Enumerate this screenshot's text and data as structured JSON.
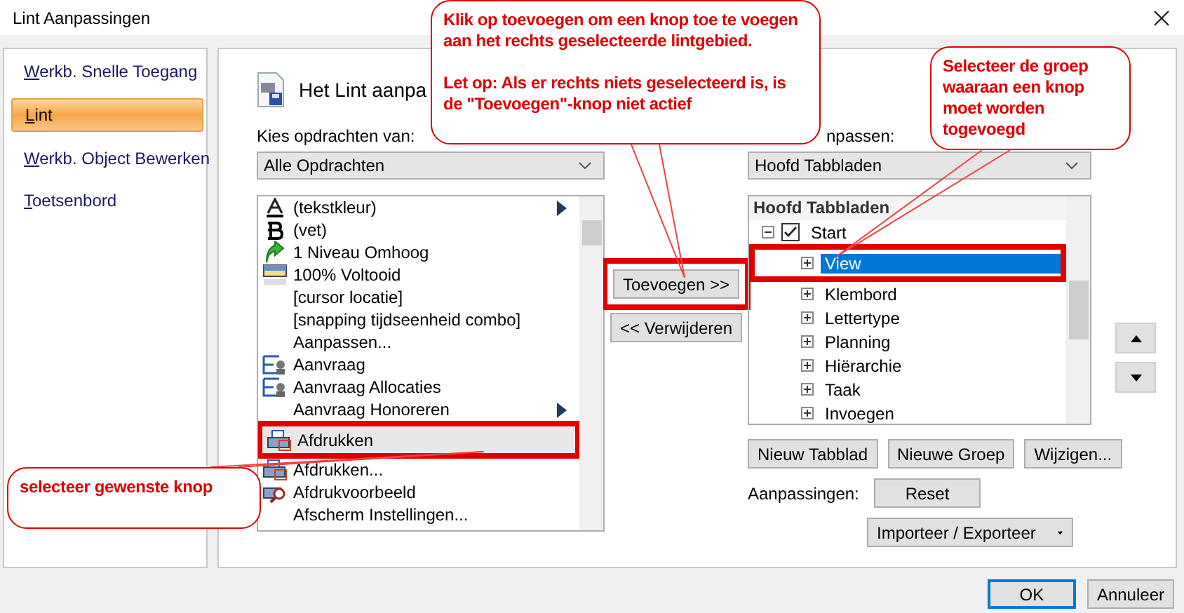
{
  "window": {
    "title": "Lint Aanpassingen"
  },
  "sidebar": {
    "items": [
      {
        "label": "Werkb. Snelle Toegang",
        "selected": false
      },
      {
        "label": "Lint",
        "selected": true
      },
      {
        "label": "Werkb. Object Bewerken",
        "selected": false
      },
      {
        "label": "Toetsenbord",
        "selected": false
      }
    ]
  },
  "header": {
    "title": "Het Lint aanpa"
  },
  "commands": {
    "label": "Kies opdrachten van:",
    "dropdown": "Alle Opdrachten",
    "items": [
      {
        "label": "(tekstkleur)",
        "kind": "text-color",
        "submenu": true,
        "selected": false,
        "highlighted": false
      },
      {
        "label": "(vet)",
        "kind": "bold",
        "submenu": false,
        "selected": false,
        "highlighted": false
      },
      {
        "label": "1 Niveau Omhoog",
        "kind": "up-arrow",
        "submenu": false,
        "selected": false,
        "highlighted": false
      },
      {
        "label": "100% Voltooid",
        "kind": "progress",
        "submenu": false,
        "selected": false,
        "highlighted": false
      },
      {
        "label": "[cursor locatie]",
        "kind": "none",
        "submenu": false,
        "selected": false,
        "highlighted": false
      },
      {
        "label": "[snapping tijdseenheid combo]",
        "kind": "none",
        "submenu": false,
        "selected": false,
        "highlighted": false
      },
      {
        "label": "Aanpassen...",
        "kind": "none",
        "submenu": false,
        "selected": false,
        "highlighted": false
      },
      {
        "label": "Aanvraag",
        "kind": "resource",
        "submenu": false,
        "selected": false,
        "highlighted": false
      },
      {
        "label": "Aanvraag Allocaties",
        "kind": "resource",
        "submenu": false,
        "selected": false,
        "highlighted": false
      },
      {
        "label": "Aanvraag Honoreren",
        "kind": "none",
        "submenu": true,
        "selected": false,
        "highlighted": false
      },
      {
        "label": "Afdrukken",
        "kind": "print",
        "submenu": false,
        "selected": true,
        "highlighted": true
      },
      {
        "label": "Afdrukken...",
        "kind": "print",
        "submenu": false,
        "selected": false,
        "highlighted": false
      },
      {
        "label": "Afdrukvoorbeeld",
        "kind": "print-preview",
        "submenu": false,
        "selected": false,
        "highlighted": false
      },
      {
        "label": "Afscherm Instellingen...",
        "kind": "none",
        "submenu": false,
        "selected": false,
        "highlighted": false
      }
    ]
  },
  "transfer": {
    "add": {
      "label": "Toevoegen >>",
      "highlighted": true
    },
    "remove": {
      "label": "<< Verwijderen"
    }
  },
  "ribbon": {
    "label": "npassen:",
    "dropdown": "Hoofd Tabbladen",
    "tree": {
      "heading": "Hoofd Tabbladen",
      "items": [
        {
          "label": "Start",
          "checked": true,
          "expanded": true,
          "children": [
            {
              "label": "View",
              "expanded": false,
              "selected": true,
              "highlighted": true
            },
            {
              "label": "Klembord",
              "expanded": false,
              "selected": false,
              "highlighted": false
            },
            {
              "label": "Lettertype",
              "expanded": false,
              "selected": false,
              "highlighted": false
            },
            {
              "label": "Planning",
              "expanded": false,
              "selected": false,
              "highlighted": false
            },
            {
              "label": "Hiërarchie",
              "expanded": false,
              "selected": false,
              "highlighted": false
            },
            {
              "label": "Taak",
              "expanded": false,
              "selected": false,
              "highlighted": false
            },
            {
              "label": "Invoegen",
              "expanded": false,
              "selected": false,
              "highlighted": false
            }
          ]
        }
      ]
    },
    "buttons": [
      "Nieuw Tabblad",
      "Nieuwe Groep",
      "Wijzigen..."
    ],
    "customizations": {
      "label": "Aanpassingen:",
      "reset": "Reset",
      "import_export": "Importeer / Exporteer"
    }
  },
  "footer": {
    "buttons": [
      {
        "label": "OK",
        "default": true
      },
      {
        "label": "Annuleer",
        "default": false
      }
    ]
  },
  "callouts": [
    {
      "paragraphs": [
        "Klik op toevoegen om een knop toe te voegen aan het rechts geselecteerde lintgebied.",
        "Let op: Als er rechts niets geselecteerd is, is de \"Toevoegen\"-knop niet actief"
      ]
    },
    {
      "paragraphs": [
        "Selecteer de groep waaraan een knop moet worden togevoegd"
      ]
    },
    {
      "paragraphs": [
        "selecteer gewenste knop"
      ]
    }
  ]
}
